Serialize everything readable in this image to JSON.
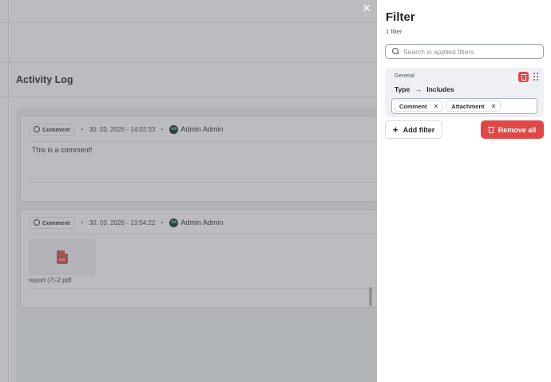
{
  "activity_log": {
    "title": "Activity Log",
    "entries": [
      {
        "type": "Comment",
        "datetime": "30. 03. 2026 - 14:02:33",
        "author_initials": "AA",
        "author": "Admin Admin",
        "text": "This is a comment!"
      },
      {
        "type": "Comment",
        "datetime": "30. 03. 2026 - 13:54:22",
        "author_initials": "AA",
        "author": "Admin Admin",
        "file_badge": "PDF",
        "file_name": "report (7)-2.pdf"
      }
    ]
  },
  "filter_panel": {
    "title": "Filter",
    "count": "1 filter",
    "search_placeholder": "Search in applied filters",
    "group": {
      "label": "General",
      "field": "Type",
      "operator": "Includes",
      "values": [
        "Comment",
        "Attachment"
      ]
    },
    "add_filter_label": "Add filter",
    "remove_all_label": "Remove all"
  },
  "icons": {
    "close": "close-icon",
    "search": "search-icon",
    "trash": "trash-icon",
    "drag": "drag-handle-icon",
    "plus": "plus-icon",
    "comment": "comment-icon",
    "pdf": "pdf-file-icon"
  },
  "colors": {
    "danger": "#e04848",
    "overlay": "#5a5f66",
    "avatar_bg": "#0f2a22"
  }
}
